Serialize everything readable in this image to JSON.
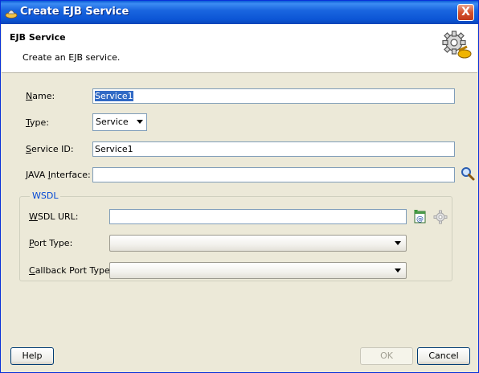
{
  "window": {
    "title": "Create EJB Service",
    "close_label": "X"
  },
  "header": {
    "title": "EJB Service",
    "subtitle": "Create an EJB service."
  },
  "form": {
    "name": {
      "label_u": "N",
      "label_rest": "ame:",
      "value": "Service1"
    },
    "type": {
      "label_u": "T",
      "label_rest": "ype:",
      "value": "Service"
    },
    "service_id": {
      "label_u": "S",
      "label_rest": "ervice ID:",
      "value": "Service1"
    },
    "java_interface": {
      "label_pre": "JAVA ",
      "label_u": "I",
      "label_rest": "nterface:",
      "value": ""
    }
  },
  "wsdl": {
    "legend": "WSDL",
    "url": {
      "label_u": "W",
      "label_rest": "SDL URL:",
      "value": ""
    },
    "port_type": {
      "label_u": "P",
      "label_rest": "ort Type:",
      "value": ""
    },
    "callback_port_type": {
      "label_u": "C",
      "label_rest": "allback Port Type:",
      "value": ""
    }
  },
  "buttons": {
    "help": "Help",
    "ok": "OK",
    "cancel": "Cancel"
  }
}
